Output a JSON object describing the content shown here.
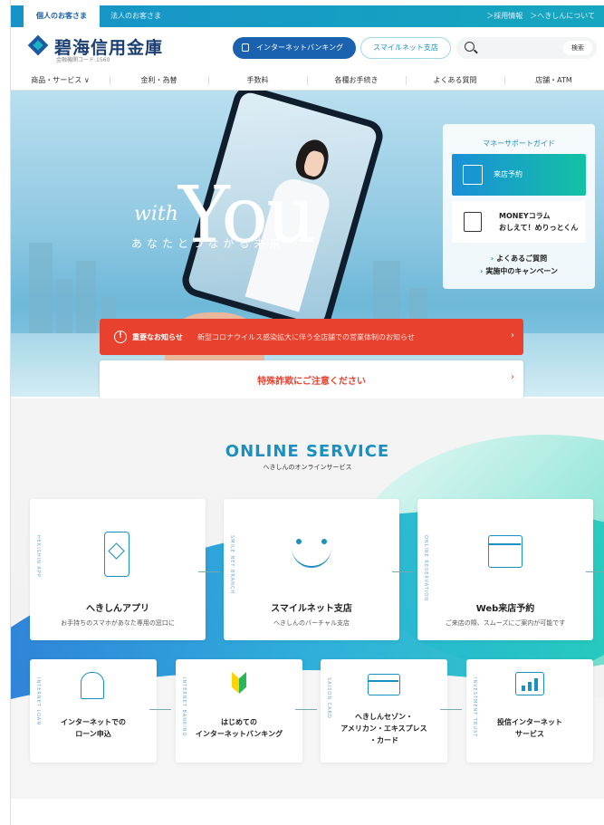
{
  "topbar": {
    "tab_personal": "個人のお客さま",
    "tab_corporate": "法人のお客さま",
    "links": "＞採用情報　＞へきしんについて"
  },
  "header": {
    "logo_text": "碧海信用金庫",
    "logo_sub": "金融機関コード:1560",
    "ib_button": "インターネットバンキング",
    "smile_button": "スマイルネット支店",
    "search_placeholder": "",
    "search_button": "検索"
  },
  "nav": {
    "items": [
      "商品・サービス ∨",
      "金利・為替",
      "手数料",
      "各種お手続き",
      "よくある質問",
      "店舗・ATM"
    ]
  },
  "hero": {
    "with": "with",
    "you": "You",
    "tagline": "あなたとつながる未来"
  },
  "guide": {
    "title": "マネーサポートガイド",
    "card1": "来店予約",
    "card2_line1": "MONEYコラム",
    "card2_line2": "おしえて！めりっとくん",
    "link1": "よくあるご質問",
    "link2": "実施中のキャンペーン"
  },
  "notices": {
    "important_label": "重要なお知らせ",
    "important_text": "新型コロナウイルス感染拡大に伴う全店舗での営業体制のお知らせ",
    "fraud": "特殊詐欺にご注意ください",
    "arrow": "›"
  },
  "online": {
    "title": "ONLINE SERVICE",
    "subtitle": "へきしんのオンラインサービス",
    "cards_top": [
      {
        "vt": "HEKISHIN APP",
        "title": "へきしんアプリ",
        "sub": "お手持ちのスマホがあなた専用の窓口に"
      },
      {
        "vt": "SMILE NET BRANCH",
        "title": "スマイルネット支店",
        "sub": "へきしんのバーチャル支店"
      },
      {
        "vt": "ONLINE RESERVATION",
        "title": "Web来店予約",
        "sub": "ご来店の際、スムーズにご案内が可能です"
      }
    ],
    "cards_bottom": [
      {
        "vt": "INTERNET LOAN",
        "title1": "インターネットでの",
        "title2": "ローン申込",
        "title3": ""
      },
      {
        "vt": "INTERNET BANKING",
        "title1": "はじめての",
        "title2": "インターネットバンキング",
        "title3": ""
      },
      {
        "vt": "SAISON CARD",
        "title1": "へきしんセゾン・",
        "title2": "アメリカン・エキスプレス",
        "title3": "・カード"
      },
      {
        "vt": "INVESTMENT TRUST",
        "title1": "投信インターネット",
        "title2": "サービス",
        "title3": ""
      }
    ]
  }
}
